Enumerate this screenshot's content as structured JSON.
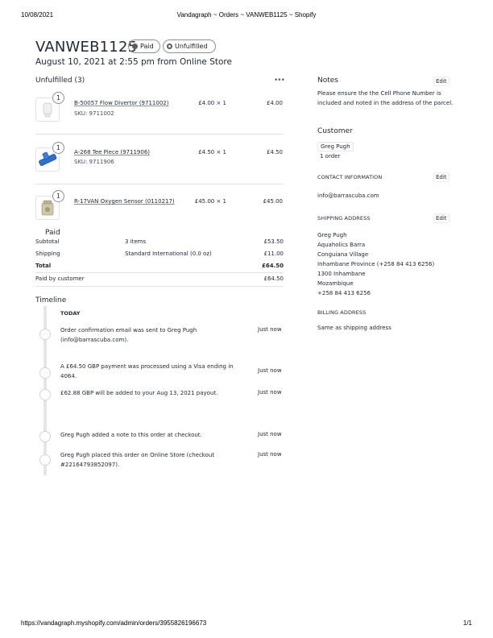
{
  "print": {
    "date": "10/08/2021",
    "title": "Vandagraph ~ Orders ~ VANWEB1125 ~ Shopify",
    "url": "https://vandagraph.myshopify.com/admin/orders/3955826196673",
    "page": "1/1"
  },
  "order": {
    "number": "VANWEB1125",
    "badges": {
      "paid": "Paid",
      "unfulfilled": "Unfulfilled"
    },
    "subtitle": "August 10, 2021 at 2:55 pm from Online Store"
  },
  "unfulfilled": {
    "title": "Unfulfilled (3)",
    "more": "•••",
    "items": [
      {
        "qty": "1",
        "name": "B-50057 Flow Divertor (9711002)",
        "sku": "SKU: 9711002",
        "price": "£4.00 × 1",
        "total": "£4.00",
        "icon": "flow-divertor-image"
      },
      {
        "qty": "1",
        "name": "A-268 Tee Piece (9711906)",
        "sku": "SKU: 9711906",
        "price": "£4.50 × 1",
        "total": "£4.50",
        "icon": "tee-piece-image"
      },
      {
        "qty": "1",
        "name": "R-17VAN Oxygen Sensor (0110217)",
        "sku": "",
        "price": "£45.00 × 1",
        "total": "£45.00",
        "icon": "oxygen-sensor-image"
      }
    ]
  },
  "paid": {
    "title": "Paid",
    "rows": [
      {
        "label": "Subtotal",
        "detail": "3 items",
        "amount": "£53.50"
      },
      {
        "label": "Shipping",
        "detail": "Standard International (0.0 oz)",
        "amount": "£11.00"
      },
      {
        "label": "Total",
        "detail": "",
        "amount": "£64.50"
      },
      {
        "label": "Paid by customer",
        "detail": "",
        "amount": "£64.50"
      }
    ]
  },
  "timeline": {
    "title": "Timeline",
    "today": "TODAY",
    "events": [
      {
        "text": "Order confirmation email was sent to Greg Pugh (info@barrascuba.com).",
        "time": "Just now"
      },
      {
        "text": "A £64.50 GBP payment was processed using a Visa ending in 4064.",
        "time": "Just now"
      },
      {
        "text": "£62.88 GBP will be added to your Aug 13, 2021 payout.",
        "time": "Just now"
      },
      {
        "text": "Greg Pugh added a note to this order at checkout.",
        "time": "Just now"
      },
      {
        "text": "Greg Pugh placed this order on Online Store (checkout #22164793852097).",
        "time": "Just now"
      }
    ]
  },
  "notes": {
    "title": "Notes",
    "edit": "Edit",
    "text": "Please ensure the the Cell Phone Number is included and noted in the address of the parcel."
  },
  "customer": {
    "title": "Customer",
    "name": "Greg Pugh",
    "orders": "1 order",
    "contact_title": "CONTACT INFORMATION",
    "contact_edit": "Edit",
    "email": "info@barrascuba.com",
    "shipping_title": "SHIPPING ADDRESS",
    "shipping_edit": "Edit",
    "shipping_lines": [
      "Greg Pugh",
      "Aquaholics Barra",
      "Conguiana Village",
      "Inhambane Province (+258 84 413 6256)",
      "1300 Inhambane",
      "Mozambique",
      "+258 84 413 6256"
    ],
    "billing_title": "BILLING ADDRESS",
    "billing_text": "Same as shipping address"
  }
}
